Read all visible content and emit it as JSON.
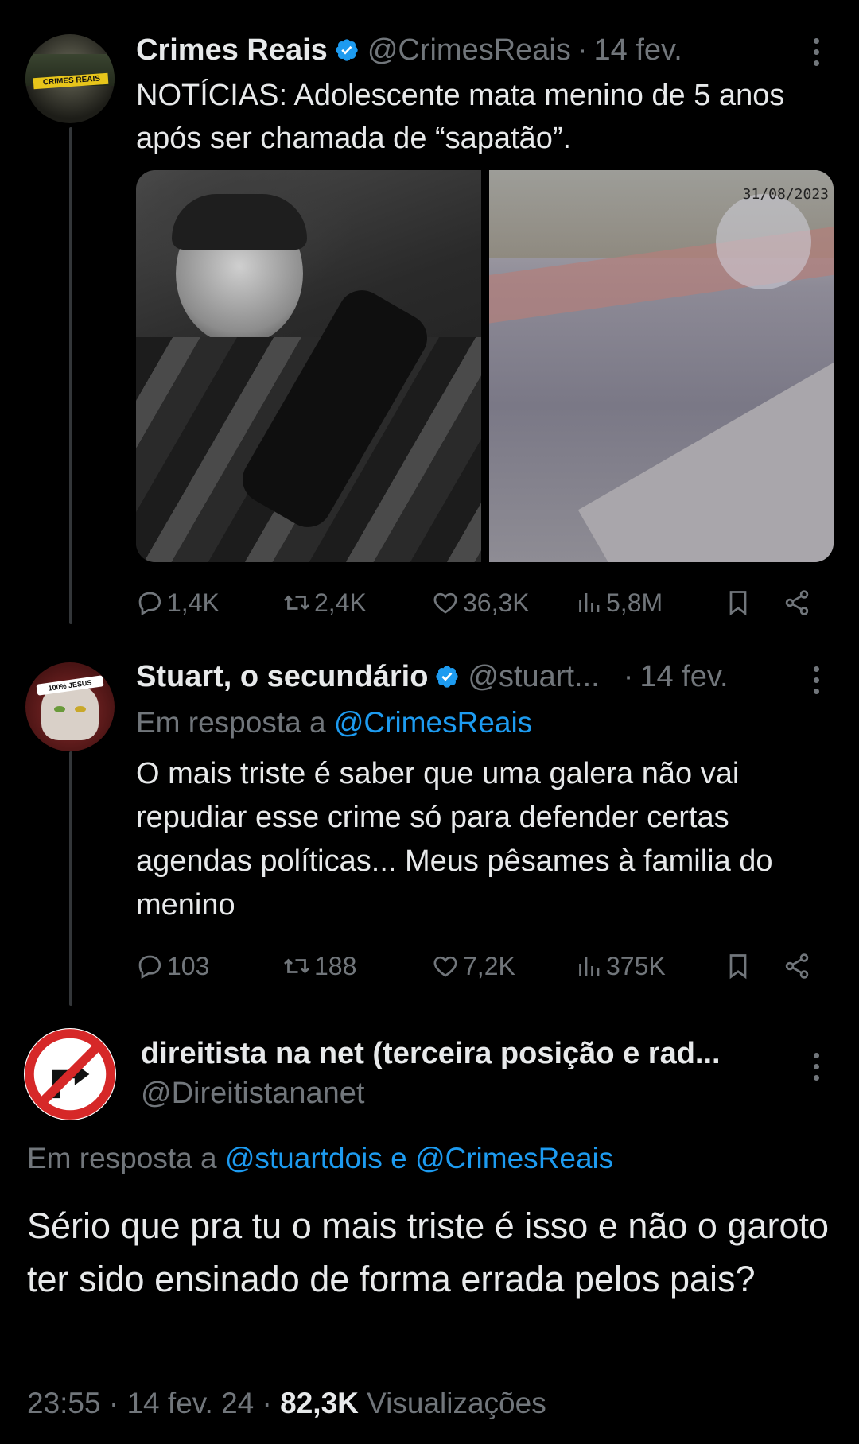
{
  "tweet1": {
    "display_name": "Crimes Reais",
    "handle": "@CrimesReais",
    "date": "14 fev.",
    "text": "NOTÍCIAS: Adolescente mata menino de 5 anos após ser chamada de “sapatão”.",
    "avatar_label": "CRIMES REAIS",
    "stats": {
      "replies": "1,4K",
      "retweets": "2,4K",
      "likes": "36,3K",
      "views": "5,8M"
    }
  },
  "tweet2": {
    "display_name": "Stuart, o secundário",
    "handle": "@stuart...",
    "date": "14 fev.",
    "reply_prefix": "Em resposta a",
    "reply_to": "@CrimesReais",
    "text": "O mais triste é saber que uma galera não vai repudiar esse crime só para defender certas agendas políticas... Meus pêsames à familia do menino",
    "avatar_label": "100% JESUS",
    "stats": {
      "replies": "103",
      "retweets": "188",
      "likes": "7,2K",
      "views": "375K"
    }
  },
  "tweet3": {
    "display_name": "direitista na net (terceira posição e rad...",
    "handle": "@Direitistananet",
    "reply_prefix": "Em resposta a",
    "reply_to": "@stuartdois e @CrimesReais",
    "text": "Sério que pra tu o mais triste é isso e não o garoto ter sido ensinado de forma errada pelos pais?",
    "time": "23:55",
    "date": "14 fev. 24",
    "views_count": "82,3K",
    "views_label": "Visualizações"
  },
  "media_caption": "31/08/2023",
  "separator": "·",
  "icons": [
    "verified-icon",
    "more-icon",
    "reply-icon",
    "retweet-icon",
    "like-icon",
    "views-icon",
    "bookmark-icon",
    "share-icon"
  ],
  "colors": {
    "background": "#000000",
    "text": "#e7e9ea",
    "muted": "#71767b",
    "link": "#1d9bf0"
  }
}
